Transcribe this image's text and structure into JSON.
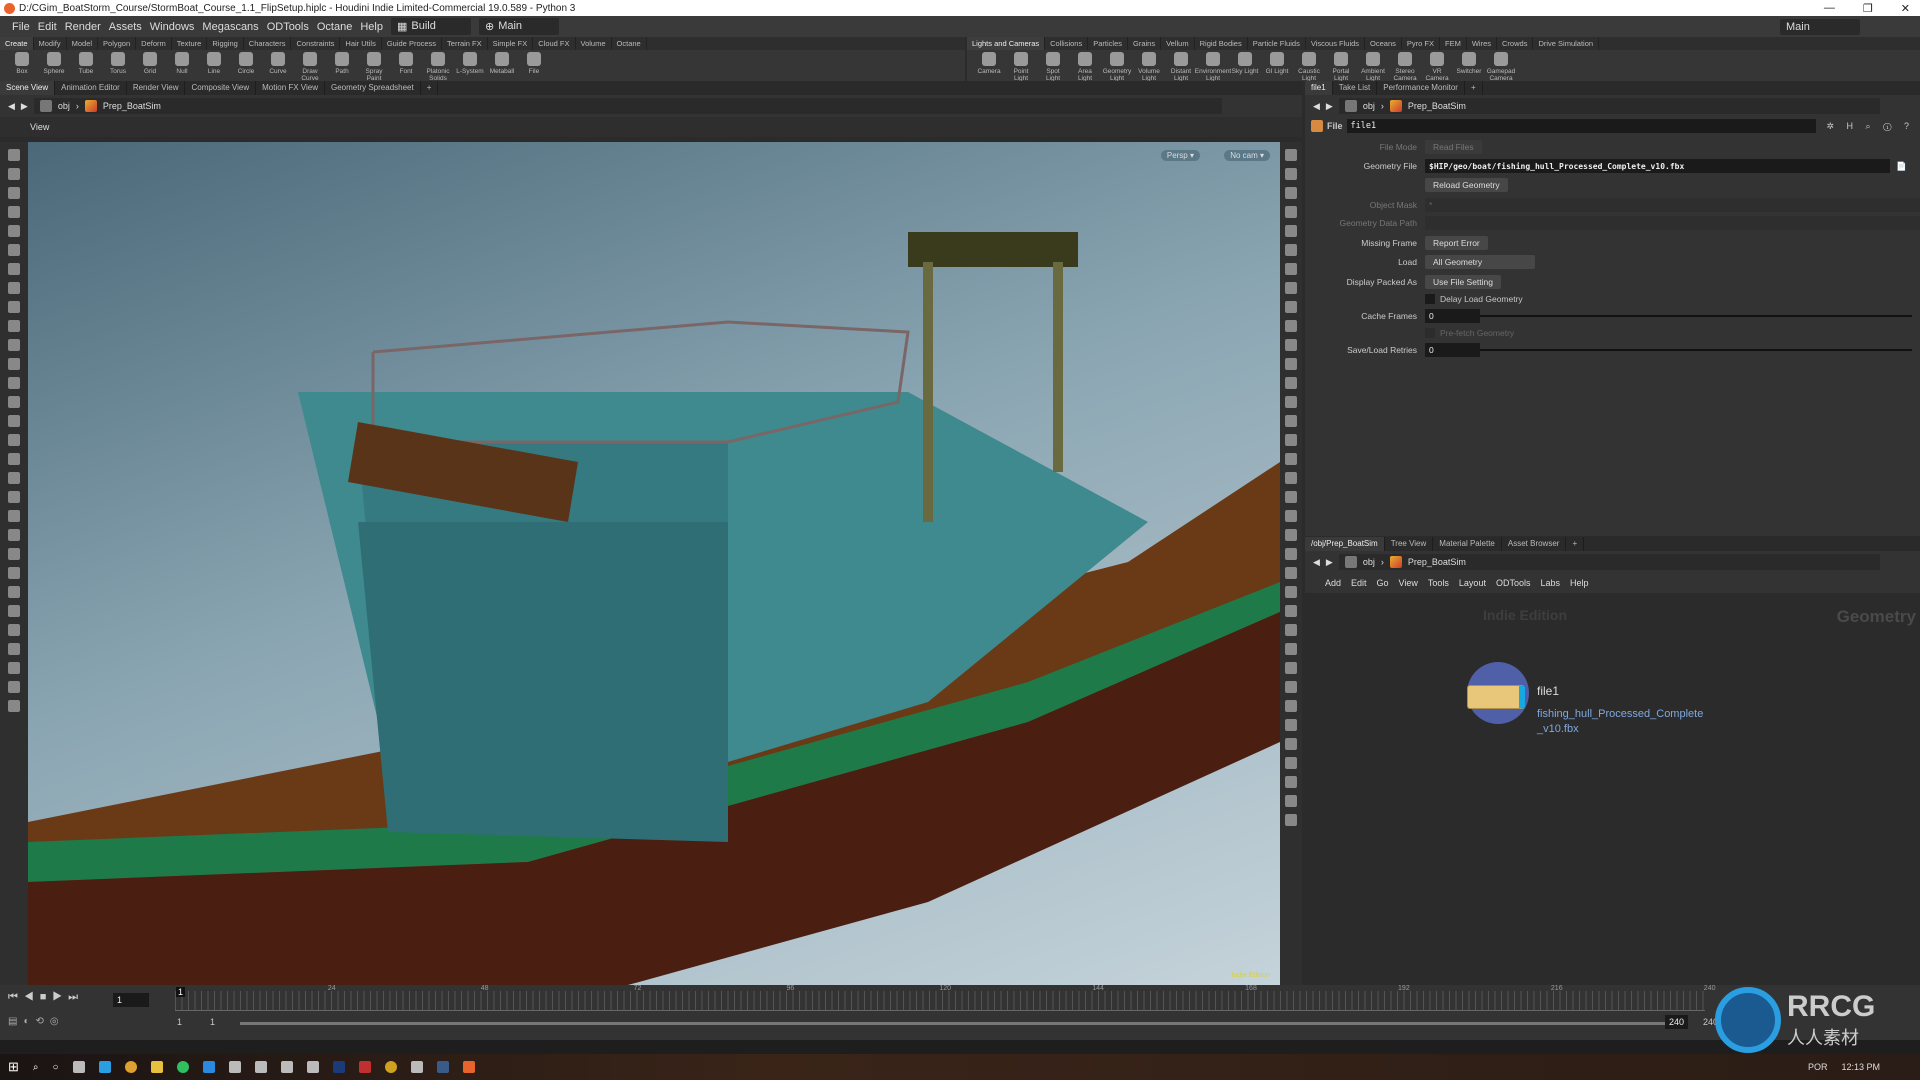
{
  "window": {
    "title": "D:/CGim_BoatStorm_Course/StormBoat_Course_1.1_FlipSetup.hiplc - Houdini Indie Limited-Commercial 19.0.589 - Python 3",
    "controls": [
      "—",
      "❐",
      "✕"
    ]
  },
  "menubar": {
    "items": [
      "File",
      "Edit",
      "Render",
      "Assets",
      "Windows",
      "Megascans",
      "ODTools",
      "Octane",
      "Help"
    ],
    "desktop": "Build",
    "context": "Main",
    "right_desktop": "Main"
  },
  "shelf_left": {
    "tabs": [
      "Create",
      "Modify",
      "Model",
      "Polygon",
      "Deform",
      "Texture",
      "Rigging",
      "Characters",
      "Constraints",
      "Hair Utils",
      "Guide Process",
      "Terrain FX",
      "Simple FX",
      "Cloud FX",
      "Volume",
      "Octane"
    ],
    "tools": [
      "Box",
      "Sphere",
      "Tube",
      "Torus",
      "Grid",
      "Null",
      "Line",
      "Circle",
      "Curve",
      "Draw Curve",
      "Path",
      "Spray Paint",
      "Font",
      "Platonic Solids",
      "L-System",
      "Metaball",
      "File"
    ]
  },
  "shelf_right": {
    "tabs": [
      "Lights and Cameras",
      "Collisions",
      "Particles",
      "Grains",
      "Vellum",
      "Rigid Bodies",
      "Particle Fluids",
      "Viscous Fluids",
      "Oceans",
      "Pyro FX",
      "FEM",
      "Wires",
      "Crowds",
      "Drive Simulation"
    ],
    "tools": [
      "Camera",
      "Point Light",
      "Spot Light",
      "Area Light",
      "Geometry Light",
      "Volume Light",
      "Distant Light",
      "Environment Light",
      "Sky Light",
      "GI Light",
      "Caustic Light",
      "Portal Light",
      "Ambient Light",
      "Stereo Camera",
      "VR Camera",
      "Switcher",
      "Gamepad Camera"
    ]
  },
  "scene_pane": {
    "tabs": [
      "Scene View",
      "Animation Editor",
      "Render View",
      "Composite View",
      "Motion FX View",
      "Geometry Spreadsheet"
    ],
    "path": [
      "obj",
      "Prep_BoatSim"
    ],
    "view_label": "View",
    "persp": "Persp ▾",
    "cam": "No cam ▾",
    "watermark": "Indie Edition"
  },
  "param_pane": {
    "tabs": [
      "file1",
      "Take List",
      "Performance Monitor"
    ],
    "path": [
      "obj",
      "Prep_BoatSim"
    ],
    "node_type": "File",
    "node_name": "file1",
    "params": {
      "file_mode_label": "File Mode",
      "file_mode": "Read Files",
      "geometry_file_label": "Geometry File",
      "geometry_file": "$HIP/geo/boat/fishing_hull_Processed_Complete_v10.fbx",
      "reload": "Reload Geometry",
      "object_mask_label": "Object Mask",
      "object_mask": "*",
      "data_path_label": "Geometry Data Path",
      "missing_frame_label": "Missing Frame",
      "missing_frame": "Report Error",
      "load_label": "Load",
      "load": "All Geometry",
      "display_packed_label": "Display Packed As",
      "display_packed": "Use File Setting",
      "delay_load": "Delay Load Geometry",
      "cache_frames_label": "Cache Frames",
      "cache_frames": "0",
      "prefetch": "Pre-fetch Geometry",
      "retries_label": "Save/Load Retries",
      "retries": "0"
    }
  },
  "network_pane": {
    "tabs": [
      "/obj/Prep_BoatSim",
      "Tree View",
      "Material Palette",
      "Asset Browser"
    ],
    "path": [
      "obj",
      "Prep_BoatSim"
    ],
    "menu": [
      "Add",
      "Edit",
      "Go",
      "View",
      "Tools",
      "Layout",
      "ODTools",
      "Labs",
      "Help"
    ],
    "watermark": "Indie Edition",
    "context": "Geometry",
    "node": {
      "name": "file1",
      "file_line1": "fishing_hull_Processed_Complete",
      "file_line2": "_v10.fbx"
    }
  },
  "timeline": {
    "current_frame": "1",
    "ticks": [
      "24",
      "48",
      "72",
      "96",
      "120",
      "144",
      "168",
      "192",
      "216",
      "240"
    ],
    "range_start": "1",
    "range_start2": "1",
    "range_end": "240",
    "range_end2": "240"
  },
  "taskbar": {
    "lang": "POR",
    "time": "12:13 PM"
  },
  "watermark": {
    "brand": "RRCG",
    "subtitle": "人人素材"
  },
  "colors": {
    "accent": "#e8642c",
    "node_file": "#e8c77a",
    "link": "#7fa8e0"
  }
}
